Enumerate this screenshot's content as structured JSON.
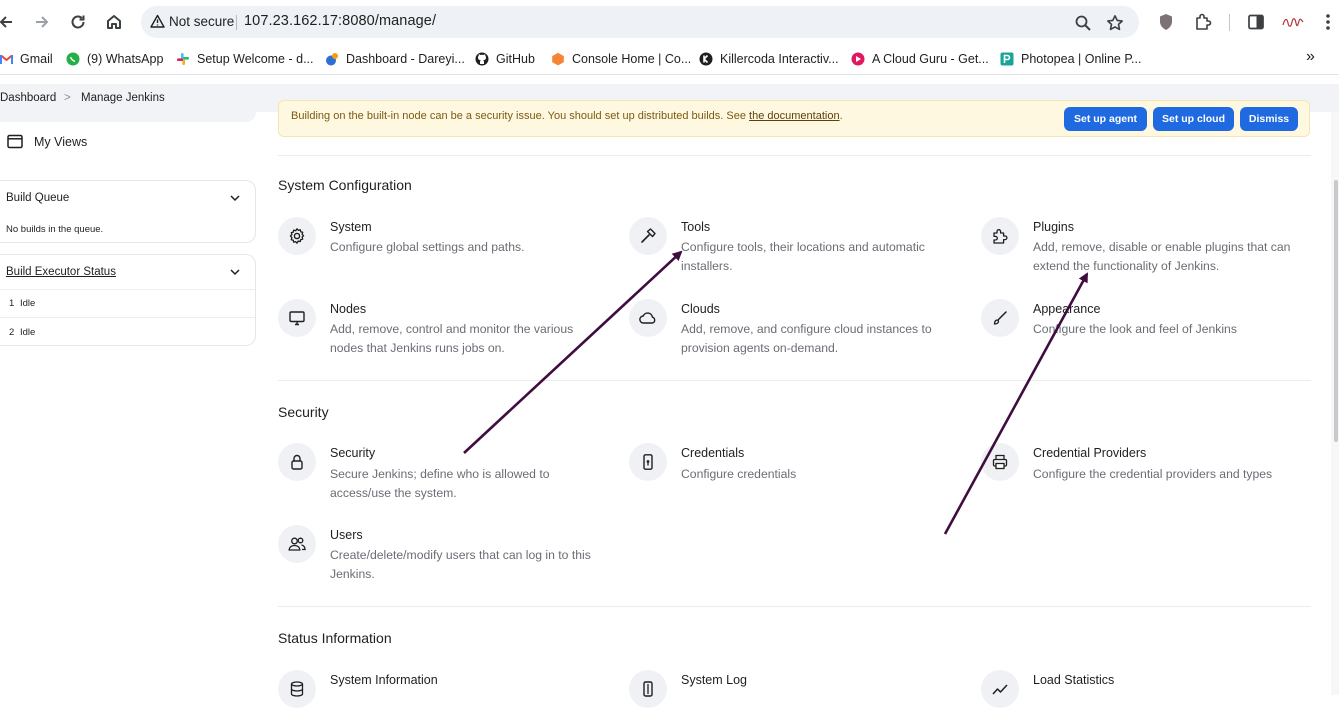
{
  "browser": {
    "security_label": "Not secure",
    "url": "107.23.162.17:8080/manage/",
    "bookmarks": [
      {
        "label": "Gmail",
        "icon": "gmail-icon"
      },
      {
        "label": "(9) WhatsApp",
        "icon": "whatsapp-icon"
      },
      {
        "label": "Setup Welcome - d...",
        "icon": "slack-icon"
      },
      {
        "label": "Dashboard - Dareyi...",
        "icon": "dashboard-icon"
      },
      {
        "label": "GitHub",
        "icon": "github-icon"
      },
      {
        "label": "Console Home | Co...",
        "icon": "aws-icon"
      },
      {
        "label": "Killercoda Interactiv...",
        "icon": "killercoda-icon"
      },
      {
        "label": "A Cloud Guru - Get...",
        "icon": "acloudguru-icon"
      },
      {
        "label": "Photopea | Online P...",
        "icon": "photopea-icon"
      }
    ],
    "more_label": "»"
  },
  "breadcrumb": {
    "items": [
      "Dashboard",
      "Manage Jenkins"
    ],
    "separator": ">"
  },
  "sidebar": {
    "my_views": "My Views",
    "build_queue": {
      "title": "Build Queue",
      "empty": "No builds in the queue."
    },
    "executors": {
      "title": "Build Executor Status",
      "rows": [
        {
          "num": "1",
          "status": "Idle"
        },
        {
          "num": "2",
          "status": "Idle"
        }
      ]
    }
  },
  "banner": {
    "text": "Building on the built-in node can be a security issue. You should set up distributed builds. See",
    "link": "the documentation",
    "end": ".",
    "buttons": [
      "Set up agent",
      "Set up cloud",
      "Dismiss"
    ]
  },
  "sections": [
    {
      "title": "System Configuration",
      "items": [
        {
          "title": "System",
          "desc": [
            "Configure global settings and paths."
          ],
          "icon": "gear-icon"
        },
        {
          "title": "Tools",
          "desc": [
            "Configure tools, their locations and automatic",
            "installers."
          ],
          "icon": "hammer-icon"
        },
        {
          "title": "Plugins",
          "desc": [
            "Add, remove, disable or enable plugins that can",
            "extend the functionality of Jenkins."
          ],
          "icon": "puzzle-icon"
        },
        {
          "title": "Nodes",
          "desc": [
            "Add, remove, control and monitor the various",
            "nodes that Jenkins runs jobs on."
          ],
          "icon": "monitor-icon"
        },
        {
          "title": "Clouds",
          "desc": [
            "Add, remove, and configure cloud instances to",
            "provision agents on-demand."
          ],
          "icon": "cloud-icon"
        },
        {
          "title": "Appearance",
          "desc": [
            "Configure the look and feel of Jenkins"
          ],
          "icon": "brush-icon"
        }
      ]
    },
    {
      "title": "Security",
      "items": [
        {
          "title": "Security",
          "desc": [
            "Secure Jenkins; define who is allowed to",
            "access/use the system."
          ],
          "icon": "lock-icon"
        },
        {
          "title": "Credentials",
          "desc": [
            "Configure credentials"
          ],
          "icon": "phone-key-icon"
        },
        {
          "title": "Credential Providers",
          "desc": [
            "Configure the credential providers and types"
          ],
          "icon": "printer-icon"
        },
        {
          "title": "Users",
          "desc": [
            "Create/delete/modify users that can log in to this",
            "Jenkins."
          ],
          "icon": "users-icon"
        }
      ]
    },
    {
      "title": "Status Information",
      "items": [
        {
          "title": "System Information",
          "desc": [],
          "icon": "database-icon"
        },
        {
          "title": "System Log",
          "desc": [],
          "icon": "log-icon"
        },
        {
          "title": "Load Statistics",
          "desc": [],
          "icon": "chart-line-icon"
        }
      ]
    }
  ],
  "colors": {
    "accent": "#1f6ae0",
    "arrow": "#3f0d3f",
    "banner_bg": "#fff8e1"
  }
}
